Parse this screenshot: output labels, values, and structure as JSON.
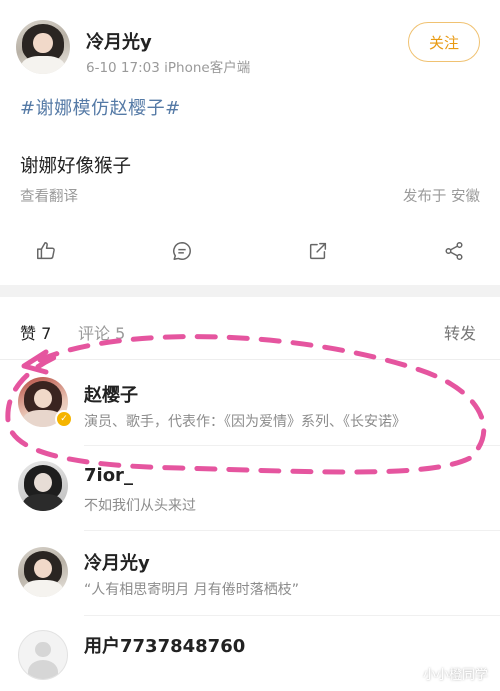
{
  "post": {
    "author": "冷月光y",
    "meta": "6-10 17:03   iPhone客户端",
    "follow_label": "关注",
    "hashtag": "#谢娜模仿赵樱子#",
    "text": "谢娜好像猴子",
    "translate_label": "查看翻译",
    "location": "发布于 安徽"
  },
  "actions": [
    {
      "icon": "like-icon"
    },
    {
      "icon": "comment-icon"
    },
    {
      "icon": "share-icon"
    },
    {
      "icon": "more-share-icon"
    }
  ],
  "tabs": {
    "likes": "赞 7",
    "comments": "评论 5",
    "reposts": "转发"
  },
  "likers": [
    {
      "name": "赵樱子",
      "desc": "演员、歌手，代表作：《因为爱情》系列、《长安诺》",
      "verified": true
    },
    {
      "name": "7ior_",
      "desc": "不如我们从头来过"
    },
    {
      "name": "冷月光y",
      "desc": "“人有相思寄明月 月有倦时落栖枝”"
    },
    {
      "name": "用户7737848760",
      "desc": ""
    }
  ],
  "watermark": "小小橙同学",
  "colors": {
    "follow_border": "#f0c272",
    "follow_text": "#e89a12",
    "hashtag": "#557aa6",
    "annotation": "#e5559f",
    "verified_badge": "#f5b400"
  }
}
